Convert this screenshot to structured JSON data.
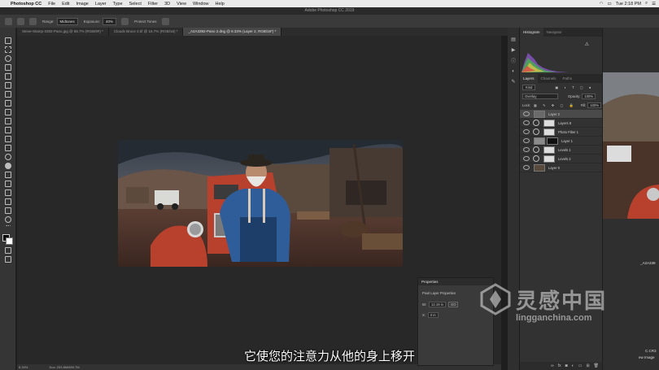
{
  "menubar": {
    "app": "Photoshop CC",
    "items": [
      "File",
      "Edit",
      "Image",
      "Layer",
      "Type",
      "Select",
      "Filter",
      "3D",
      "View",
      "Window",
      "Help"
    ],
    "time": "Tue 2:18 PM"
  },
  "window_title": "Adobe Photoshop CC 2019",
  "options": {
    "range_label": "Range:",
    "range_value": "Midtones",
    "exposure_label": "Exposure:",
    "exposure_value": "40%",
    "protect_label": "Protect Tones"
  },
  "tabs": [
    "Steve-Stamp-3392-Pano.jpg @ 66.7% (RGB/8#) *",
    "Clouds Bruce 2.tif @ 16.7% (RGB/16) *",
    "_A2A3392-Pano 2.dng @ 8.33% (Layer 2, RGB/16*) *"
  ],
  "right_panel": {
    "histogram_tabs": [
      "Histogram",
      "Navigator"
    ],
    "layers_tabs": [
      "Layers",
      "Channels",
      "Paths"
    ],
    "kind_label": "Kind",
    "blend_mode": "Overlay",
    "opacity_label": "Opacity:",
    "opacity_value": "100%",
    "lock_label": "Lock:",
    "fill_label": "Fill:",
    "fill_value": "100%",
    "layers": [
      {
        "name": "Layer 2",
        "selected": true
      },
      {
        "name": "Layers 8",
        "selected": false
      },
      {
        "name": "Photo Filter 1",
        "selected": false
      },
      {
        "name": "Layer 1",
        "selected": false
      },
      {
        "name": "Levels 1",
        "selected": false
      },
      {
        "name": "Levels 2",
        "selected": false
      },
      {
        "name": "Layer 0",
        "selected": false
      }
    ]
  },
  "properties": {
    "title": "Properties",
    "subtitle": "Pixel Layer Properties",
    "w_label": "W:",
    "w_value": "12.19 in",
    "go_label": "GO",
    "x_label": "X:",
    "x_value": "0 in"
  },
  "status": {
    "zoom": "8.33%",
    "doc": "Doc: 253.8M/659.7M"
  },
  "subtitle": "它使您的注意力从他的身上移开",
  "watermark": {
    "cn": "灵感中国",
    "en": "lingganchina.com"
  },
  "second_window": {
    "text1": "_A2A339",
    "text2": "C.CR3",
    "text3": "ew Image"
  },
  "colors": {
    "sky_top": "#2d3440",
    "rust_red": "#b8412e",
    "shirt_blue": "#2f5d9a"
  }
}
